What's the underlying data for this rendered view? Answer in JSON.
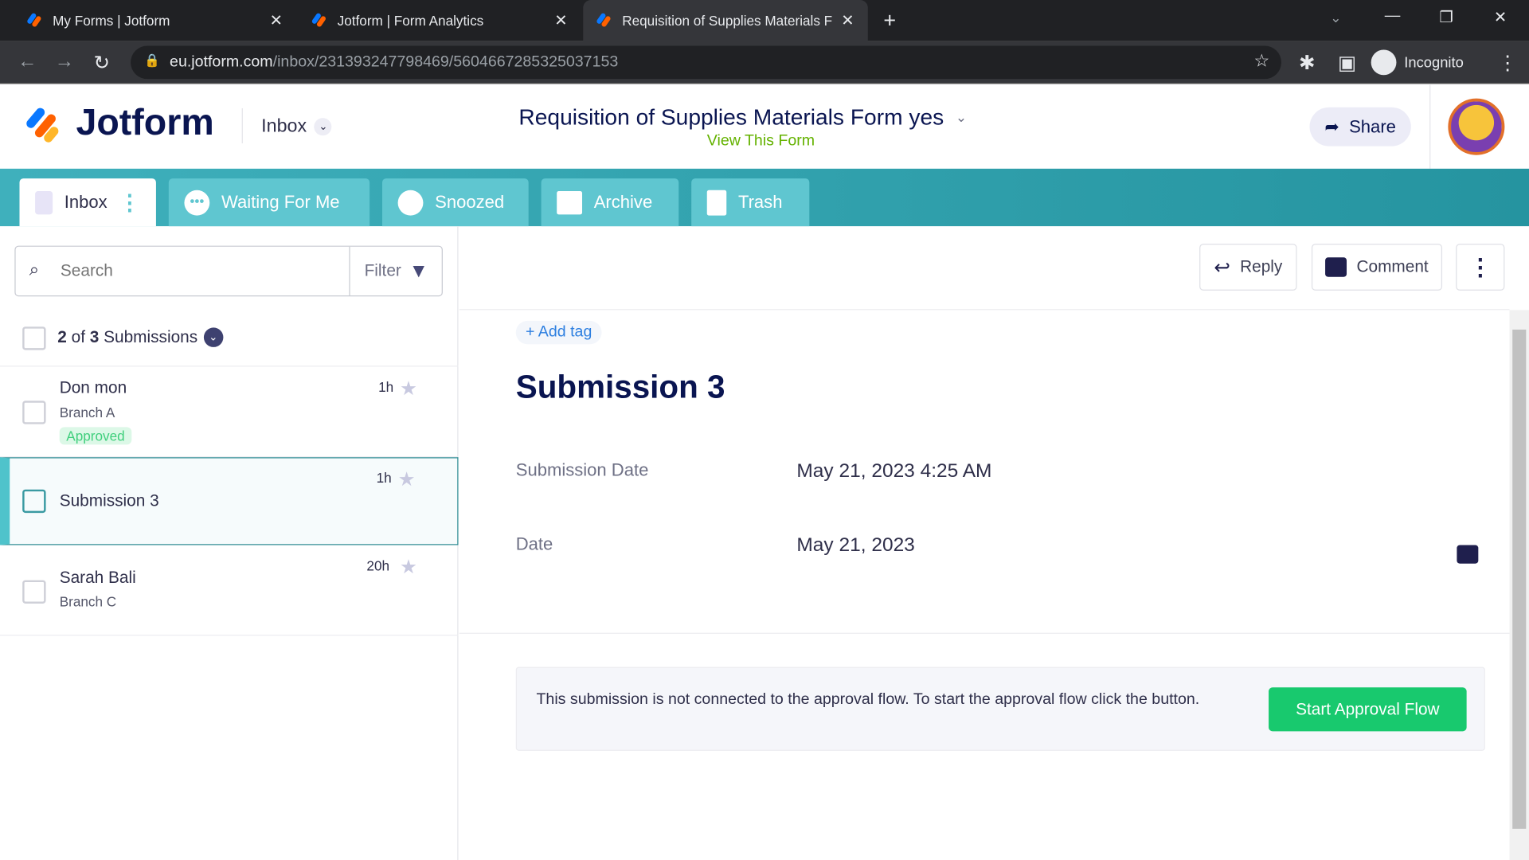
{
  "browser": {
    "tabs": [
      {
        "title": "My Forms | Jotform"
      },
      {
        "title": "Jotform | Form Analytics"
      },
      {
        "title": "Requisition of Supplies Materials Form yes"
      }
    ],
    "url_host": "eu.jotform.com",
    "url_path": "/inbox/231393247798469/5604667285325037153",
    "profile": "Incognito"
  },
  "header": {
    "logo": "Jotform",
    "inbox_label": "Inbox",
    "form_title": "Requisition of Supplies Materials Form yes",
    "view_form": "View This Form",
    "share": "Share"
  },
  "inbox_tabs": [
    {
      "label": "Inbox"
    },
    {
      "label": "Waiting For Me"
    },
    {
      "label": "Snoozed"
    },
    {
      "label": "Archive"
    },
    {
      "label": "Trash"
    }
  ],
  "list": {
    "search_placeholder": "Search",
    "filter": "Filter",
    "count_a": "2",
    "count_of": " of ",
    "count_b": "3",
    "count_label": " Submissions",
    "items": [
      {
        "name": "Don mon",
        "sub": "Branch A",
        "badge": "Approved",
        "time": "1h"
      },
      {
        "name": "Submission 3",
        "time": "1h",
        "selected": true
      },
      {
        "name": "Sarah Bali",
        "sub": "Branch C",
        "time": "20h"
      }
    ]
  },
  "detail": {
    "reply": "Reply",
    "comment": "Comment",
    "add_tag": "Add tag",
    "title": "Submission 3",
    "fields": [
      {
        "label": "Submission Date",
        "value": "May 21, 2023 4:25 AM"
      },
      {
        "label": "Date",
        "value": "May 21, 2023"
      }
    ],
    "approval_text": "This submission is not connected to the approval flow. To start the approval flow click the button.",
    "approval_button": "Start Approval Flow"
  },
  "colors": {
    "teal": "#2594a0",
    "green": "#18c96e",
    "navy": "#1f1f4d"
  }
}
